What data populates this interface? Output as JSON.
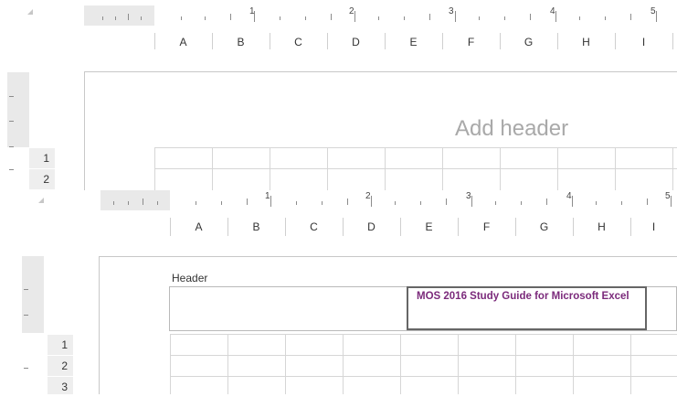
{
  "top_view": {
    "ruler_numbers": [
      "1",
      "2",
      "3",
      "4",
      "5"
    ],
    "columns": [
      "A",
      "B",
      "C",
      "D",
      "E",
      "F",
      "G",
      "H",
      "I"
    ],
    "rows": [
      "1",
      "2"
    ],
    "add_header_text": "Add header"
  },
  "bottom_view": {
    "ruler_numbers": [
      "1",
      "2",
      "3",
      "4",
      "5"
    ],
    "columns": [
      "A",
      "B",
      "C",
      "D",
      "E",
      "F",
      "G",
      "H",
      "I"
    ],
    "rows": [
      "1",
      "2",
      "3"
    ],
    "header_label": "Header",
    "header_text": "MOS 2016 Study Guide for Microsoft Excel"
  },
  "colors": {
    "header_text": "#7b2a7b",
    "ruler_gray": "#e9e9e9",
    "grid": "#d6d6d6"
  }
}
